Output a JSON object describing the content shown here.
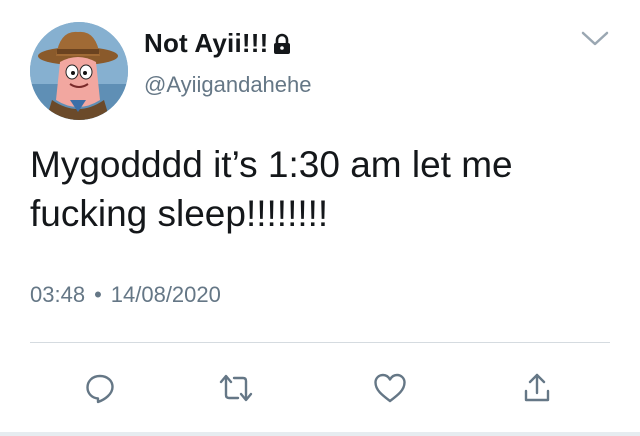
{
  "author": {
    "display_name": "Not Ayii!!!",
    "handle": "@Ayiigandahehe",
    "avatar": "cartoon-cowboy-starfish-avatar",
    "protected": true
  },
  "tweet": {
    "text": "Mygodddd it’s 1:30 am let me fucking sleep!!!!!!!!",
    "time": "03:48",
    "separator": "•",
    "date": "14/08/2020"
  },
  "icons": {
    "lock": "lock-icon",
    "menu": "chevron-down-icon",
    "reply": "reply-icon",
    "retweet": "retweet-icon",
    "like": "heart-icon",
    "share": "share-icon"
  },
  "colors": {
    "text": "#14171a",
    "secondary": "#657786",
    "icon": "#657786",
    "divider": "#d5dbe0"
  }
}
